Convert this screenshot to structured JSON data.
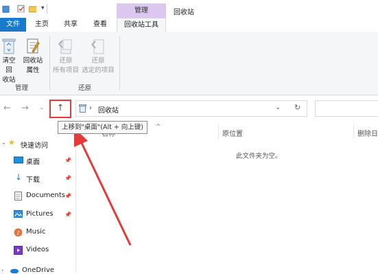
{
  "window": {
    "title": "回收站",
    "context_tab_header": "管理"
  },
  "ribbon_tabs": {
    "file": "文件",
    "home": "主页",
    "share": "共享",
    "view": "查看",
    "recycle_tools": "回收站工具"
  },
  "ribbon": {
    "empty_bin": "清空回\n收站",
    "empty_bin_l1": "清空回",
    "empty_bin_l2": "收站",
    "properties_l1": "回收站",
    "properties_l2": "属性",
    "restore_all_l1": "还原",
    "restore_all_l2": "所有项目",
    "restore_sel_l1": "还原",
    "restore_sel_l2": "选定的项目",
    "group_manage": "管理",
    "group_restore": "还原"
  },
  "address": {
    "path": "回收站",
    "up_tooltip": "上移到\"桌面\"(Alt + 向上键)"
  },
  "sidebar": {
    "quick_access": "快速访问",
    "items": [
      {
        "label": "桌面",
        "pinned": true
      },
      {
        "label": "下载",
        "pinned": true
      },
      {
        "label": "Documents",
        "pinned": true
      },
      {
        "label": "Pictures",
        "pinned": true
      },
      {
        "label": "Music",
        "pinned": false
      },
      {
        "label": "Videos",
        "pinned": false
      }
    ],
    "onedrive": "OneDrive"
  },
  "columns": {
    "name": "名称",
    "original_location": "原位置",
    "date_deleted": "删除日"
  },
  "content": {
    "empty_message": "此文件夹为空。"
  },
  "colors": {
    "file_tab": "#1979ca",
    "context_header": "#dbc7ef",
    "highlight_red": "#e43a3a"
  }
}
